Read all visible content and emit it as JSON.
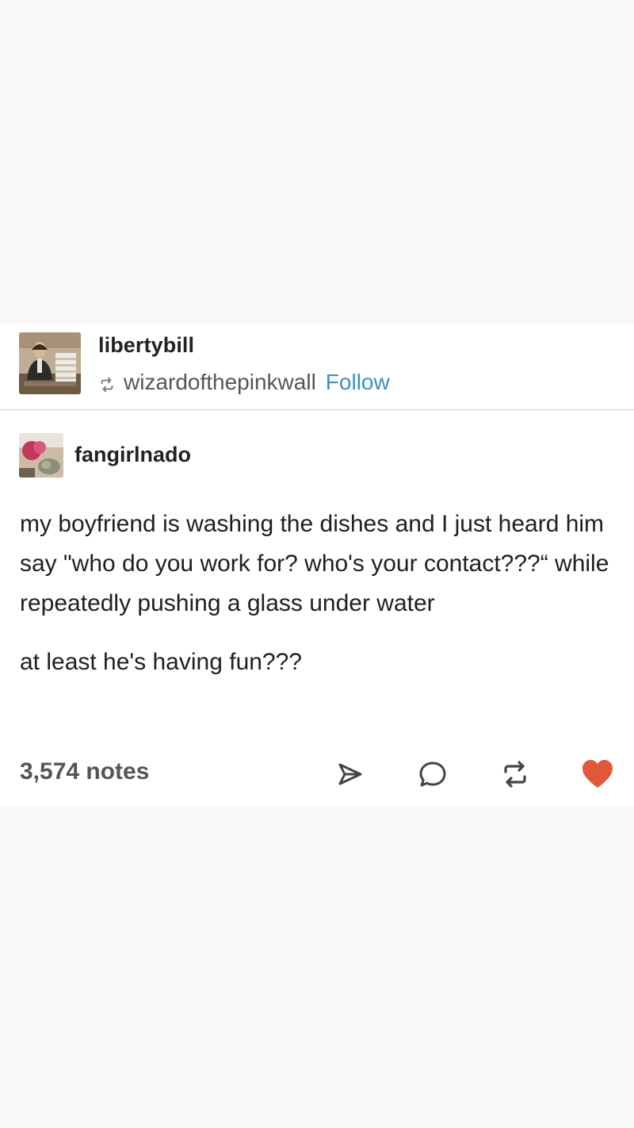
{
  "post": {
    "reblog": {
      "author": "libertybill",
      "via": "wizardofthepinkwall",
      "follow_label": "Follow",
      "reblog_icon": "reblog-icon"
    },
    "trail": {
      "author": "fangirlnado",
      "paragraphs": [
        "my boyfriend is washing the dishes and I just heard him say \"who do you work for? who's your contact???“ while repeatedly pushing a glass under water",
        "at least he's having fun???"
      ]
    },
    "footer": {
      "notes": "3,574 notes",
      "actions": [
        "share-icon",
        "comment-icon",
        "reblog-icon",
        "heart-icon"
      ]
    }
  },
  "colors": {
    "link": "#3f8fbf",
    "heart": "#e2563a",
    "icon": "#444444",
    "page_background": "#f8f8f8"
  }
}
